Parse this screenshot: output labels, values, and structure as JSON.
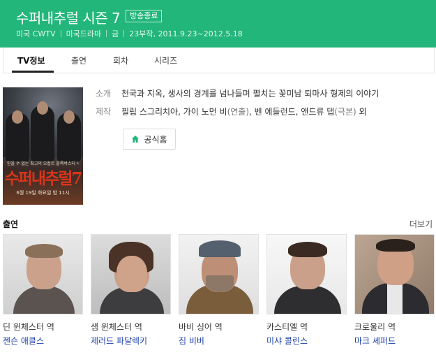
{
  "header": {
    "title": "수퍼내추럴 시즌 7",
    "badge": "방송종료",
    "meta": [
      "미국 CWTV",
      "미국드라마",
      "금",
      "23부작, 2011.9.23~2012.5.18"
    ],
    "bg_color": "#22b67a"
  },
  "tabs": [
    {
      "label": "TV정보",
      "active": true
    },
    {
      "label": "출연",
      "active": false
    },
    {
      "label": "회차",
      "active": false
    },
    {
      "label": "시리즈",
      "active": false
    }
  ],
  "poster": {
    "tagline": "믿을 수 없는 최고의 오컬트 블록버스터 시리즈",
    "logo_text": "수퍼내추럴7",
    "air_info": "6월 19일 화요일 밤 11시"
  },
  "info": {
    "summary_label": "소개",
    "summary": "천국과 지옥, 생사의 경계를 넘나들며 펼치는 꽃미남 퇴마사 형제의 이야기",
    "staff_label": "제작",
    "staff_prefix": "필립 스그리치아, 가이 노먼 비",
    "staff_paren1": "(연출)",
    "staff_mid": ", 벤 에들런드, 앤드류 댑",
    "staff_paren2": "(극본)",
    "staff_suffix": " 외",
    "homepage_label": "공식홈",
    "homepage_icon": "home-icon"
  },
  "cast": {
    "title": "출연",
    "more_label": "더보기",
    "members": [
      {
        "role": "딘 윈체스터 역",
        "actor": "젠슨 애클스"
      },
      {
        "role": "샘 윈체스터 역",
        "actor": "제러드 파달렉키"
      },
      {
        "role": "바비 싱어 역",
        "actor": "짐 비버"
      },
      {
        "role": "카스티엘 역",
        "actor": "미샤 콜린스"
      },
      {
        "role": "크로울리 역",
        "actor": "마크 셰퍼드"
      }
    ]
  }
}
